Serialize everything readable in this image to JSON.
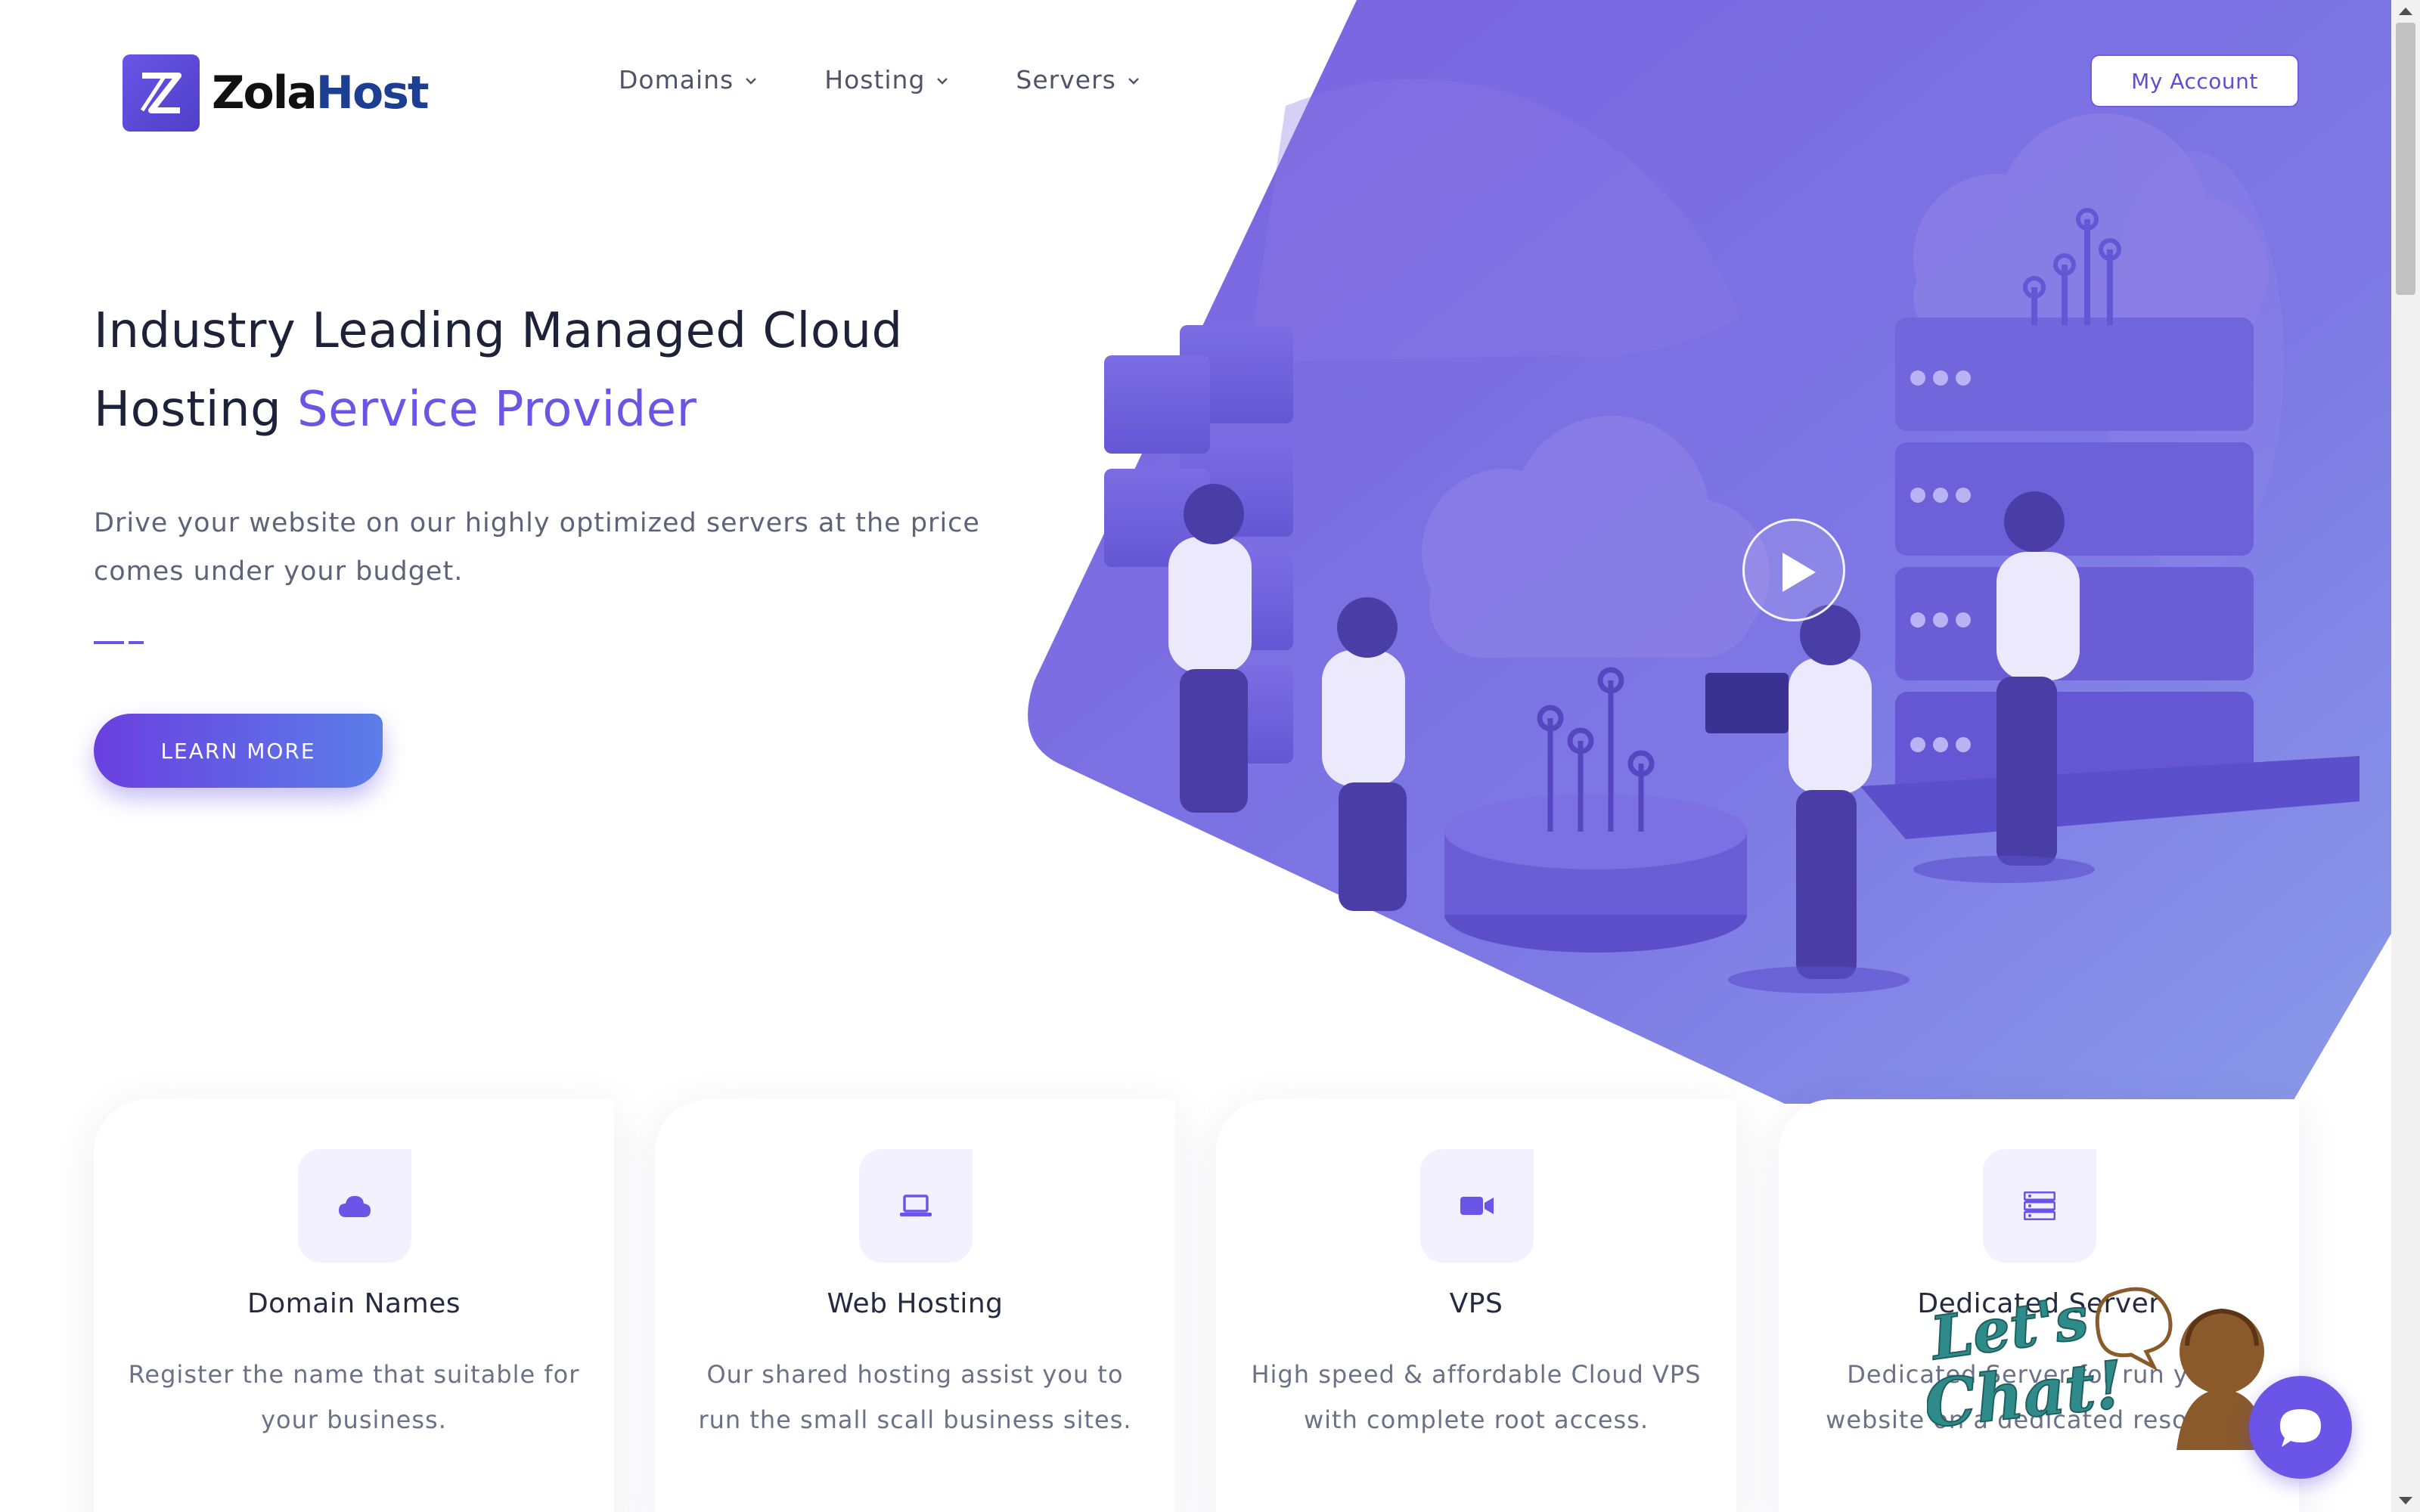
{
  "brand": {
    "name_part1": "Zola",
    "name_part2": "Host",
    "accent_color": "#6a55e6"
  },
  "nav": {
    "items": [
      {
        "label": "Domains"
      },
      {
        "label": "Hosting"
      },
      {
        "label": "Servers"
      }
    ],
    "account_label": "My Account"
  },
  "hero": {
    "title_line": "Industry Leading Managed Cloud Hosting ",
    "title_accent": "Service Provider",
    "subtitle": "Drive your website on our highly optimized servers at the price comes under your budget.",
    "cta_label": "LEARN MORE",
    "video_icon": "play-icon"
  },
  "services": [
    {
      "icon": "cloud-icon",
      "title": "Domain Names",
      "desc": "Register the name that suitable for your business."
    },
    {
      "icon": "laptop-icon",
      "title": "Web Hosting",
      "desc": "Our shared hosting assist you to run the small scall business sites."
    },
    {
      "icon": "video-camera-icon",
      "title": "VPS",
      "desc": "High speed & affordable Cloud VPS with complete root access."
    },
    {
      "icon": "server-icon",
      "title": "Dedicated Server",
      "desc": "Dedicated Server for run your website on a dedicated resource."
    }
  ],
  "chat": {
    "label": "Let's Chat!",
    "icon": "chat-bubble-icon"
  }
}
